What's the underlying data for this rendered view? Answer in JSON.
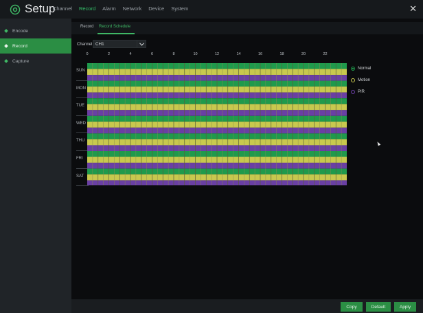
{
  "app": {
    "title": "Setup",
    "close_glyph": "✕",
    "logo_icon": "gear-icon"
  },
  "nav": [
    {
      "label": "Channel",
      "active": false
    },
    {
      "label": "Record",
      "active": true
    },
    {
      "label": "Alarm",
      "active": false
    },
    {
      "label": "Network",
      "active": false
    },
    {
      "label": "Device",
      "active": false
    },
    {
      "label": "System",
      "active": false
    }
  ],
  "sidebar": [
    {
      "label": "Encode",
      "active": false
    },
    {
      "label": "Record",
      "active": true
    },
    {
      "label": "Capture",
      "active": false
    }
  ],
  "subtabs": [
    {
      "label": "Record",
      "active": false
    },
    {
      "label": "Record Schedule",
      "active": true
    }
  ],
  "channel": {
    "label": "Channel",
    "value": "CH1"
  },
  "hour_ticks": [
    "0",
    "2",
    "4",
    "6",
    "8",
    "10",
    "12",
    "14",
    "16",
    "18",
    "20",
    "22"
  ],
  "days": [
    "SUN",
    "MON",
    "TUE",
    "WED",
    "THU",
    "FRI",
    "SAT"
  ],
  "schedule_types": [
    {
      "name": "Normal",
      "color": "#1f9a4c",
      "selected": true
    },
    {
      "name": "Motion",
      "color": "#c8c84e",
      "selected": false
    },
    {
      "name": "PIR",
      "color": "#6a3fa4",
      "selected": false
    }
  ],
  "buttons": {
    "copy": "Copy",
    "default": "Default",
    "apply": "Apply"
  }
}
